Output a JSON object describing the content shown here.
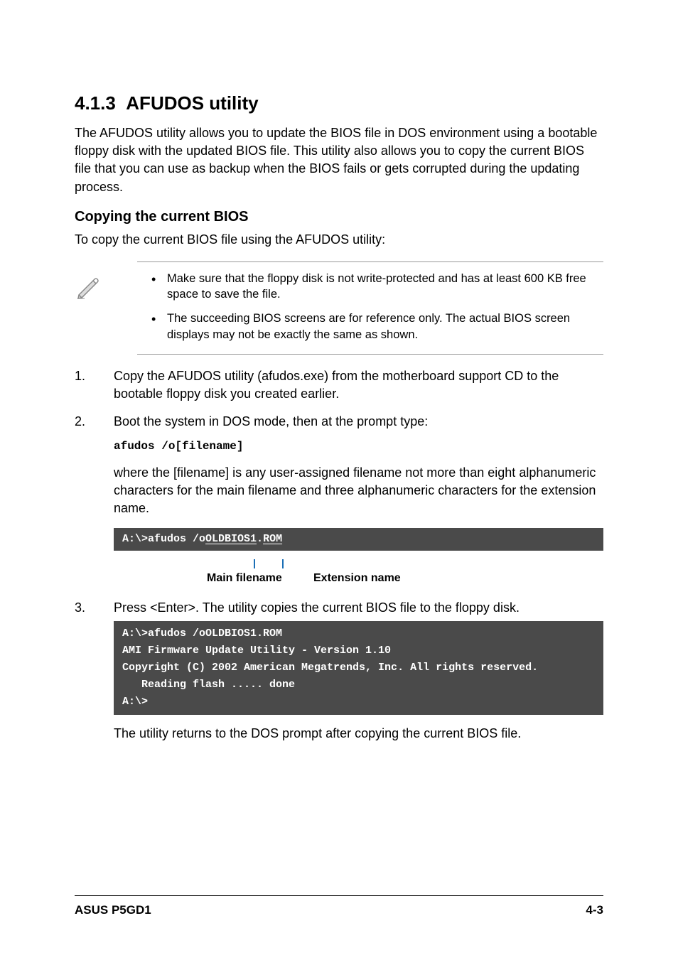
{
  "header": {
    "section_number": "4.1.3",
    "section_title": "AFUDOS utility"
  },
  "intro": "The AFUDOS utility allows you to update the BIOS file in DOS environment using a bootable floppy disk with the updated BIOS file. This utility also allows you to copy the current BIOS file that you can use as backup when the BIOS fails or gets corrupted during the updating process.",
  "subsection": {
    "title": "Copying the current BIOS",
    "lead": "To copy the current BIOS file using the AFUDOS utility:"
  },
  "notes": [
    "Make sure that the floppy disk is not write-protected and has at least 600 KB free space to save the file.",
    "The succeeding BIOS screens are for reference only. The actual BIOS screen displays may not be exactly the same as shown."
  ],
  "steps": {
    "s1": "Copy the AFUDOS utility (afudos.exe) from the motherboard support CD to the bootable floppy disk you created earlier.",
    "s2": "Boot the system in DOS mode, then at the prompt type:",
    "s2_cmd": "afudos /o[filename]",
    "s2_para": "where the [filename] is any user-assigned filename not more than eight alphanumeric characters  for the main filename and three alphanumeric characters for the extension name.",
    "s3": "Press <Enter>. The utility copies the current BIOS file to the floppy disk.",
    "s3_after": "The utility returns to the DOS prompt after copying the current BIOS file."
  },
  "terminal1": {
    "prefix": "A:\\>afudos /o",
    "main": "OLDBIOS1",
    "dot": ".",
    "ext": "ROM"
  },
  "labels": {
    "main": "Main filename",
    "ext": "Extension name"
  },
  "terminal2": {
    "l1": "A:\\>afudos /oOLDBIOS1.ROM",
    "l2": "AMI Firmware Update Utility - Version 1.10",
    "l3": "Copyright (C) 2002 American Megatrends, Inc. All rights reserved.",
    "l4": "   Reading flash ..... done",
    "l5": "A:\\>"
  },
  "footer": {
    "left": "ASUS P5GD1",
    "right": "4-3"
  }
}
